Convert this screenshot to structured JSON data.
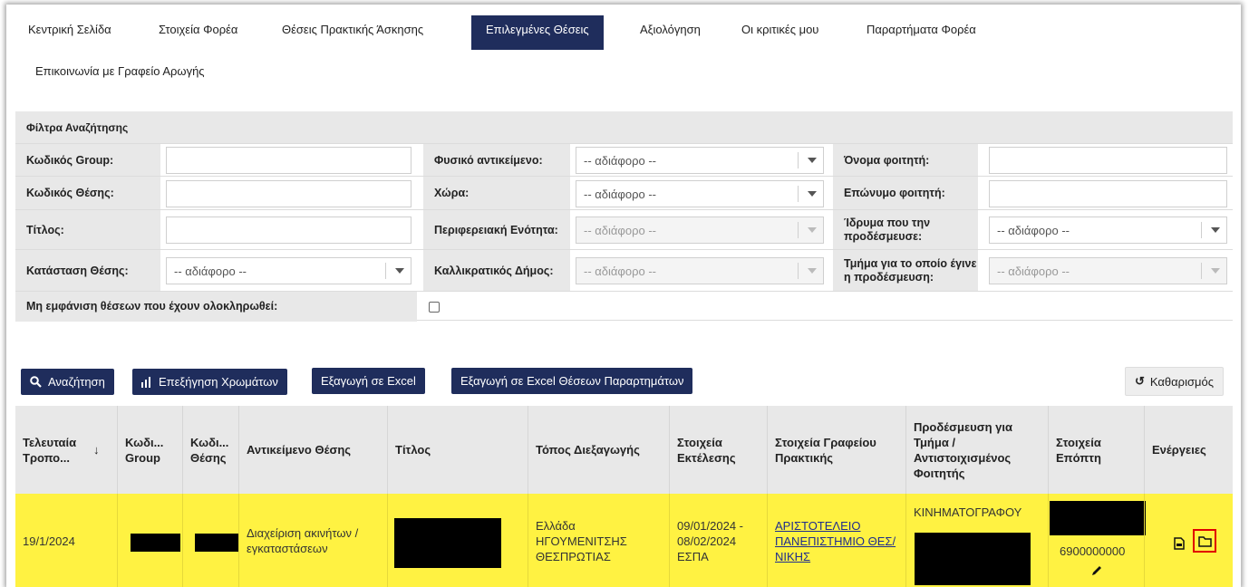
{
  "nav": {
    "items": [
      {
        "label": "Κεντρική Σελίδα",
        "active": false
      },
      {
        "label": "Στοιχεία Φορέα",
        "active": false
      },
      {
        "label": "Θέσεις Πρακτικής Άσκησης",
        "active": false
      },
      {
        "label": "Επιλεγμένες Θέσεις",
        "active": true
      },
      {
        "label": "Αξιολόγηση",
        "active": false
      },
      {
        "label": "Οι κριτικές μου",
        "active": false
      },
      {
        "label": "Παραρτήματα Φορέα",
        "active": false
      },
      {
        "label": "Επικοινωνία με Γραφείο Αρωγής",
        "active": false
      }
    ]
  },
  "filters": {
    "title": "Φίλτρα Αναζήτησης",
    "group_code_label": "Κωδικός Group:",
    "group_code_value": "",
    "object_label": "Φυσικό αντικείμενο:",
    "object_value": "-- αδιάφορο --",
    "student_name_label": "Όνομα φοιτητή:",
    "student_name_value": "",
    "position_code_label": "Κωδικός Θέσης:",
    "position_code_value": "",
    "country_label": "Χώρα:",
    "country_value": "-- αδιάφορο --",
    "student_surname_label": "Επώνυμο φοιτητή:",
    "student_surname_value": "",
    "title_label": "Τίτλος:",
    "title_value": "",
    "region_label": "Περιφερειακή Ενότητα:",
    "region_value": "-- αδιάφορο --",
    "institution_label": "Ίδρυμα που την προδέσμευσε:",
    "institution_value": "-- αδιάφορο --",
    "status_label": "Κατάσταση Θέσης:",
    "status_value": "-- αδιάφορο --",
    "municipality_label": "Καλλικρατικός Δήμος:",
    "municipality_value": "-- αδιάφορο --",
    "department_label": "Τμήμα για το οποίο έγινε η προδέσμευση:",
    "department_value": "-- αδιάφορο --",
    "hide_completed_label": "Μη εμφάνιση θέσεων που έχουν ολοκληρωθεί:",
    "hide_completed_checked": false
  },
  "actions": {
    "search": "Αναζήτηση",
    "colors": "Επεξήγηση Χρωμάτων",
    "export_excel": "Εξαγωγή σε Excel",
    "export_excel_branches": "Εξαγωγή σε Excel Θέσεων Παραρτημάτων",
    "clear": "Καθαρισμός"
  },
  "table": {
    "headers": {
      "last_modified": "Τελευταία Τροπο...",
      "sort_arrow": "↓",
      "group_code": "Κωδι... Group",
      "position_code": "Κωδι... Θέσης",
      "object": "Αντικείμενο Θέσης",
      "title": "Τίτλος",
      "location": "Τόπος Διεξαγωγής",
      "execution": "Στοιχεία Εκτέλεσης",
      "office": "Στοιχεία Γραφείου Πρακτικής",
      "prebooking": "Προδέσμευση για Τμήμα / Αντιστοιχισμένος Φοιτητής",
      "supervisor": "Στοιχεία Επόπτη",
      "actions": "Ενέργειες"
    },
    "row": {
      "last_modified": "19/1/2024",
      "object": "Διαχείριση ακινήτων / εγκαταστάσεων",
      "location": "Ελλάδα ΗΓΟΥΜΕΝΙΤΣΗΣ ΘΕΣΠΡΩΤΙΑΣ",
      "execution": "09/01/2024 - 08/02/2024 ΕΣΠΑ",
      "office": "ΑΡΙΣΤΟΤΕΛΕΙΟ ΠΑΝΕΠΙΣΤΗΜΙΟ ΘΕΣ/ΝΙΚΗΣ",
      "prebooking_dept": "ΚΙΝΗΜΑΤΟΓΡΑΦΟΥ",
      "supervisor_phone": "6900000000",
      "highlight_color": "#fff242"
    }
  },
  "colors": {
    "nav_active": "#1f2d5c",
    "button": "#1f2d5c",
    "header_bg": "#e8e8e8",
    "highlight_box": "#e00000"
  }
}
